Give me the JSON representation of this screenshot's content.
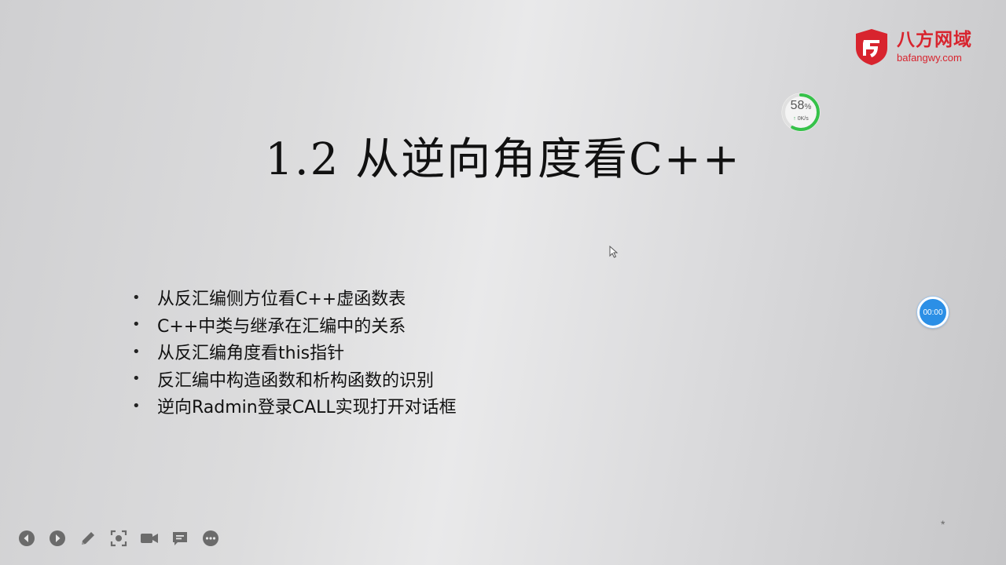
{
  "logo": {
    "name": "八方网域",
    "url": "bafangwy.com",
    "brand_color": "#d8242e"
  },
  "speed_widget": {
    "percent_value": "58",
    "percent_unit": "%",
    "percent": 58,
    "rate": "0K/s",
    "ring_color": "#36c24a"
  },
  "slide": {
    "title": "1.2 从逆向角度看C++",
    "bullets": [
      "从反汇编侧方位看C++虚函数表",
      "C++中类与继承在汇编中的关系",
      "从反汇编角度看this指针",
      "反汇编中构造函数和析构函数的识别",
      "逆向Radmin登录CALL实现打开对话框"
    ],
    "bullet_marker": "•"
  },
  "timer": {
    "text": "00:00",
    "color": "#2b8fe6"
  },
  "toolbar": {
    "items": [
      "prev-icon",
      "next-icon",
      "pen-icon",
      "screenshot-icon",
      "camera-icon",
      "comment-icon",
      "more-icon"
    ]
  },
  "corner_mark": "*"
}
